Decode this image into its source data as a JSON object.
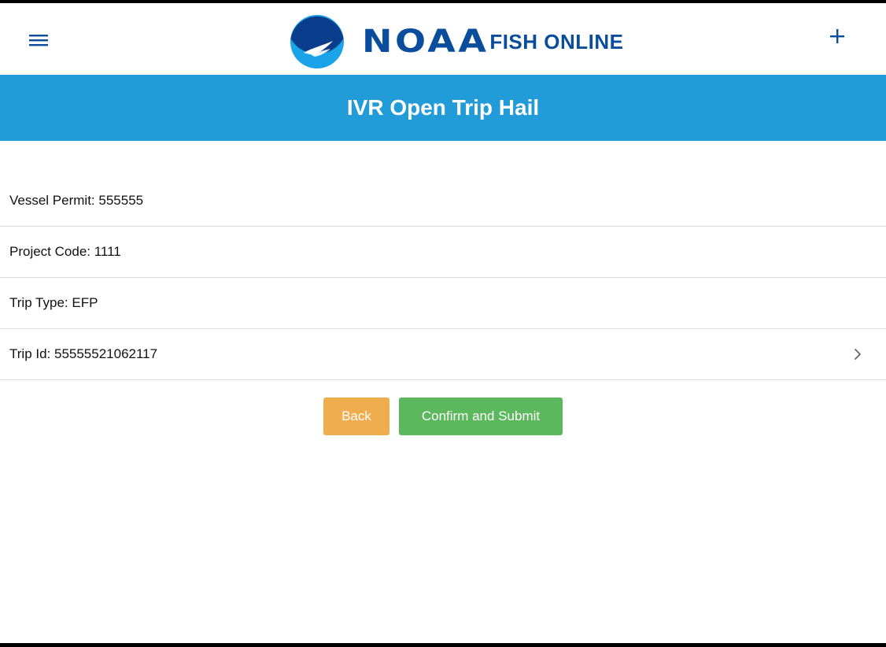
{
  "header": {
    "brand_wordmark": "NOAA",
    "brand_subtitle": "FISH ONLINE",
    "menu_icon": "hamburger-menu-icon",
    "add_icon": "plus-icon",
    "brand_color": "#0a4d9c"
  },
  "page": {
    "title": "IVR Open Trip Hail",
    "title_bar_color": "#229bd9"
  },
  "details": [
    {
      "text": "Vessel Permit: 555555",
      "has_chevron": false
    },
    {
      "text": "Project Code: 1111",
      "has_chevron": false
    },
    {
      "text": "Trip Type: EFP",
      "has_chevron": false
    },
    {
      "text": "Trip Id: 55555521062117",
      "has_chevron": true
    }
  ],
  "actions": {
    "back_label": "Back",
    "back_color": "#f0ad4e",
    "submit_label": "Confirm and Submit",
    "submit_color": "#5cb85c"
  }
}
